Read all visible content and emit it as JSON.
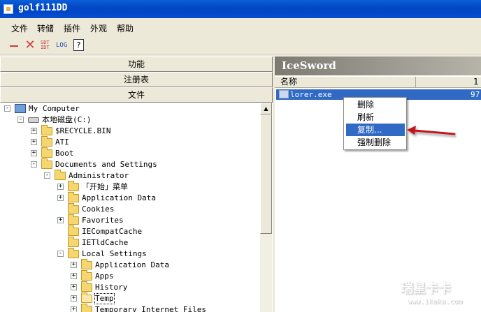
{
  "window": {
    "title": "golf111DD"
  },
  "menu": [
    "文件",
    "转储",
    "插件",
    "外观",
    "帮助"
  ],
  "toolbar": {
    "sdt_label": "SDT\nIDT",
    "log_label": "LOG",
    "help_label": "?"
  },
  "left_tabs": [
    "功能",
    "注册表",
    "文件"
  ],
  "tree": [
    {
      "label": "My Computer",
      "expander": "-",
      "icon": "computer"
    },
    {
      "label": "本地磁盘(C:)",
      "expander": "-",
      "icon": "drive"
    },
    {
      "label": "$RECYCLE.BIN",
      "expander": "+",
      "icon": "folder"
    },
    {
      "label": "ATI",
      "expander": "+",
      "icon": "folder"
    },
    {
      "label": "Boot",
      "expander": "+",
      "icon": "folder"
    },
    {
      "label": "Documents and Settings",
      "expander": "-",
      "icon": "folder"
    },
    {
      "label": "Administrator",
      "expander": "-",
      "icon": "folder"
    },
    {
      "label": "「开始」菜单",
      "expander": "+",
      "icon": "folder"
    },
    {
      "label": "Application Data",
      "expander": "+",
      "icon": "folder"
    },
    {
      "label": "Cookies",
      "expander": "",
      "icon": "folder"
    },
    {
      "label": "Favorites",
      "expander": "+",
      "icon": "folder"
    },
    {
      "label": "IECompatCache",
      "expander": "",
      "icon": "folder"
    },
    {
      "label": "IETldCache",
      "expander": "",
      "icon": "folder"
    },
    {
      "label": "Local Settings",
      "expander": "-",
      "icon": "folder"
    },
    {
      "label": "Application Data",
      "expander": "+",
      "icon": "folder"
    },
    {
      "label": "Apps",
      "expander": "+",
      "icon": "folder"
    },
    {
      "label": "History",
      "expander": "+",
      "icon": "folder"
    },
    {
      "label": "Temp",
      "expander": "+",
      "icon": "folder-open",
      "selected": true
    },
    {
      "label": "Temporary Internet Files",
      "expander": "+",
      "icon": "folder"
    }
  ],
  "right": {
    "title": "IceSword",
    "columns": {
      "name": "名称",
      "size": "1"
    },
    "file": {
      "name": "lorer.exe",
      "size": "97"
    }
  },
  "context_menu": {
    "items": [
      "删除",
      "刷新",
      "复制...",
      "强制删除"
    ],
    "highlighted": "复制..."
  },
  "watermark": {
    "main": "瑞星卡卡",
    "sub": "www.ikaka.com"
  },
  "colors": {
    "title_bar": "#0348c4",
    "selection": "#316ac5",
    "annotation_arrow": "#c0141c"
  }
}
